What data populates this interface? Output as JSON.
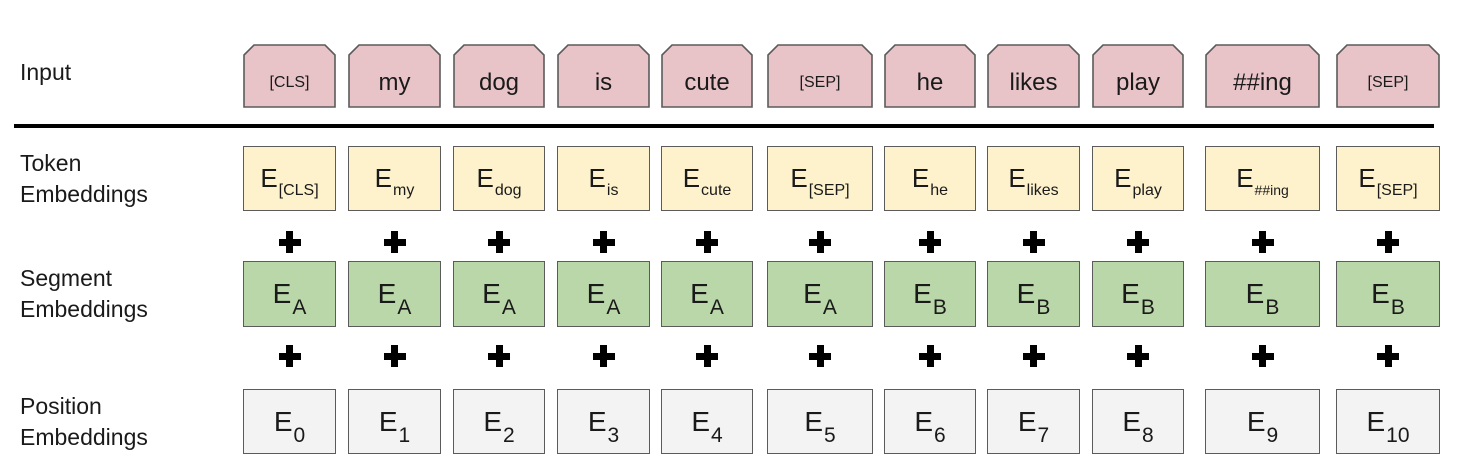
{
  "labels": {
    "input": "Input",
    "token": [
      "Token",
      "Embeddings"
    ],
    "segment": [
      "Segment",
      "Embeddings"
    ],
    "position": [
      "Position",
      "Embeddings"
    ]
  },
  "colors": {
    "input_fill": "#e8c4c8",
    "token_fill": "#fef2cd",
    "segment_fill": "#b9d7a8",
    "position_fill": "#f3f3f3",
    "border": "#5b5b5b"
  },
  "plus_symbol_icon": "plus-icon",
  "columns": [
    {
      "input": "[CLS]",
      "token": {
        "base": "E",
        "sub": "[CLS]"
      },
      "segment": {
        "base": "E",
        "sub": "A"
      },
      "position": {
        "base": "E",
        "sub": "0"
      }
    },
    {
      "input": "my",
      "token": {
        "base": "E",
        "sub": "my"
      },
      "segment": {
        "base": "E",
        "sub": "A"
      },
      "position": {
        "base": "E",
        "sub": "1"
      }
    },
    {
      "input": "dog",
      "token": {
        "base": "E",
        "sub": "dog"
      },
      "segment": {
        "base": "E",
        "sub": "A"
      },
      "position": {
        "base": "E",
        "sub": "2"
      }
    },
    {
      "input": "is",
      "token": {
        "base": "E",
        "sub": "is"
      },
      "segment": {
        "base": "E",
        "sub": "A"
      },
      "position": {
        "base": "E",
        "sub": "3"
      }
    },
    {
      "input": "cute",
      "token": {
        "base": "E",
        "sub": "cute"
      },
      "segment": {
        "base": "E",
        "sub": "A"
      },
      "position": {
        "base": "E",
        "sub": "4"
      }
    },
    {
      "input": "[SEP]",
      "token": {
        "base": "E",
        "sub": "[SEP]"
      },
      "segment": {
        "base": "E",
        "sub": "A"
      },
      "position": {
        "base": "E",
        "sub": "5"
      }
    },
    {
      "input": "he",
      "token": {
        "base": "E",
        "sub": "he"
      },
      "segment": {
        "base": "E",
        "sub": "B"
      },
      "position": {
        "base": "E",
        "sub": "6"
      }
    },
    {
      "input": "likes",
      "token": {
        "base": "E",
        "sub": "likes"
      },
      "segment": {
        "base": "E",
        "sub": "B"
      },
      "position": {
        "base": "E",
        "sub": "7"
      }
    },
    {
      "input": "play",
      "token": {
        "base": "E",
        "sub": "play"
      },
      "segment": {
        "base": "E",
        "sub": "B"
      },
      "position": {
        "base": "E",
        "sub": "8"
      }
    },
    {
      "input": "##ing",
      "token": {
        "base": "E",
        "sub": "##ing"
      },
      "segment": {
        "base": "E",
        "sub": "B"
      },
      "position": {
        "base": "E",
        "sub": "9"
      }
    },
    {
      "input": "[SEP]",
      "token": {
        "base": "E",
        "sub": "[SEP]"
      },
      "segment": {
        "base": "E",
        "sub": "B"
      },
      "position": {
        "base": "E",
        "sub": "10"
      }
    }
  ]
}
